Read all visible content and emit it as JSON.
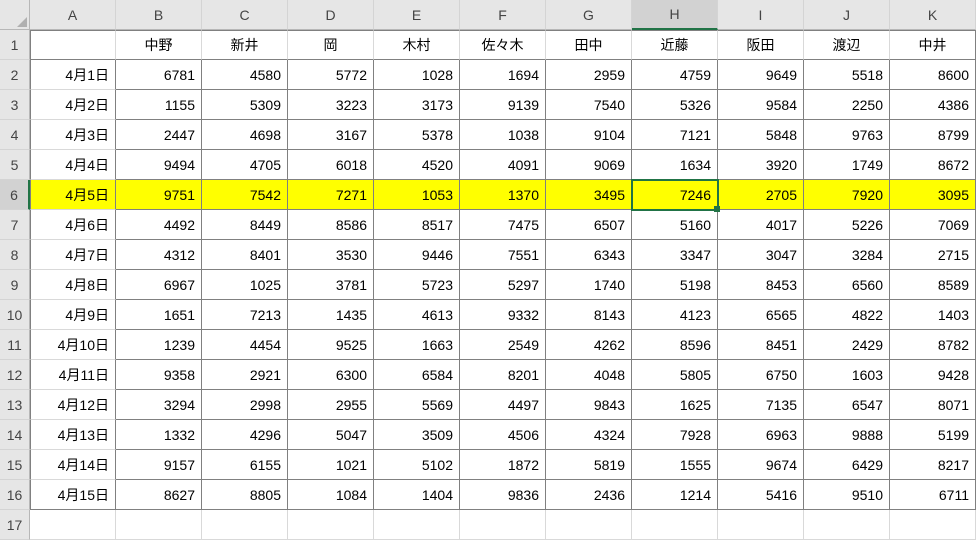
{
  "columns": [
    "A",
    "B",
    "C",
    "D",
    "E",
    "F",
    "G",
    "H",
    "I",
    "J",
    "K"
  ],
  "row_numbers": [
    1,
    2,
    3,
    4,
    5,
    6,
    7,
    8,
    9,
    10,
    11,
    12,
    13,
    14,
    15,
    16,
    17
  ],
  "header_row": [
    "",
    "中野",
    "新井",
    "岡",
    "木村",
    "佐々木",
    "田中",
    "近藤",
    "阪田",
    "渡辺",
    "中井"
  ],
  "data_rows": [
    {
      "label": "4月1日",
      "values": [
        6781,
        4580,
        5772,
        1028,
        1694,
        2959,
        4759,
        9649,
        5518,
        8600
      ]
    },
    {
      "label": "4月2日",
      "values": [
        1155,
        5309,
        3223,
        3173,
        9139,
        7540,
        5326,
        9584,
        2250,
        4386
      ]
    },
    {
      "label": "4月3日",
      "values": [
        2447,
        4698,
        3167,
        5378,
        1038,
        9104,
        7121,
        5848,
        9763,
        8799
      ]
    },
    {
      "label": "4月4日",
      "values": [
        9494,
        4705,
        6018,
        4520,
        4091,
        9069,
        1634,
        3920,
        1749,
        8672
      ]
    },
    {
      "label": "4月5日",
      "values": [
        9751,
        7542,
        7271,
        1053,
        1370,
        3495,
        7246,
        2705,
        7920,
        3095
      ]
    },
    {
      "label": "4月6日",
      "values": [
        4492,
        8449,
        8586,
        8517,
        7475,
        6507,
        5160,
        4017,
        5226,
        7069
      ]
    },
    {
      "label": "4月7日",
      "values": [
        4312,
        8401,
        3530,
        9446,
        7551,
        6343,
        3347,
        3047,
        3284,
        2715
      ]
    },
    {
      "label": "4月8日",
      "values": [
        6967,
        1025,
        3781,
        5723,
        5297,
        1740,
        5198,
        8453,
        6560,
        8589
      ]
    },
    {
      "label": "4月9日",
      "values": [
        1651,
        7213,
        1435,
        4613,
        9332,
        8143,
        4123,
        6565,
        4822,
        1403
      ]
    },
    {
      "label": "4月10日",
      "values": [
        1239,
        4454,
        9525,
        1663,
        2549,
        4262,
        8596,
        8451,
        2429,
        8782
      ]
    },
    {
      "label": "4月11日",
      "values": [
        9358,
        2921,
        6300,
        6584,
        8201,
        4048,
        5805,
        6750,
        1603,
        9428
      ]
    },
    {
      "label": "4月12日",
      "values": [
        3294,
        2998,
        2955,
        5569,
        4497,
        9843,
        1625,
        7135,
        6547,
        8071
      ]
    },
    {
      "label": "4月13日",
      "values": [
        1332,
        4296,
        5047,
        3509,
        4506,
        4324,
        7928,
        6963,
        9888,
        5199
      ]
    },
    {
      "label": "4月14日",
      "values": [
        9157,
        6155,
        1021,
        5102,
        1872,
        5819,
        1555,
        9674,
        6429,
        8217
      ]
    },
    {
      "label": "4月15日",
      "values": [
        8627,
        8805,
        1084,
        1404,
        9836,
        2436,
        1214,
        5416,
        9510,
        6711
      ]
    }
  ],
  "highlight_row_index": 4,
  "active_cell": {
    "row": 6,
    "col": "H"
  },
  "chart_data": {
    "type": "table",
    "title": "",
    "categories": [
      "中野",
      "新井",
      "岡",
      "木村",
      "佐々木",
      "田中",
      "近藤",
      "阪田",
      "渡辺",
      "中井"
    ],
    "series": [
      {
        "name": "4月1日",
        "values": [
          6781,
          4580,
          5772,
          1028,
          1694,
          2959,
          4759,
          9649,
          5518,
          8600
        ]
      },
      {
        "name": "4月2日",
        "values": [
          1155,
          5309,
          3223,
          3173,
          9139,
          7540,
          5326,
          9584,
          2250,
          4386
        ]
      },
      {
        "name": "4月3日",
        "values": [
          2447,
          4698,
          3167,
          5378,
          1038,
          9104,
          7121,
          5848,
          9763,
          8799
        ]
      },
      {
        "name": "4月4日",
        "values": [
          9494,
          4705,
          6018,
          4520,
          4091,
          9069,
          1634,
          3920,
          1749,
          8672
        ]
      },
      {
        "name": "4月5日",
        "values": [
          9751,
          7542,
          7271,
          1053,
          1370,
          3495,
          7246,
          2705,
          7920,
          3095
        ]
      },
      {
        "name": "4月6日",
        "values": [
          4492,
          8449,
          8586,
          8517,
          7475,
          6507,
          5160,
          4017,
          5226,
          7069
        ]
      },
      {
        "name": "4月7日",
        "values": [
          4312,
          8401,
          3530,
          9446,
          7551,
          6343,
          3347,
          3047,
          3284,
          2715
        ]
      },
      {
        "name": "4月8日",
        "values": [
          6967,
          1025,
          3781,
          5723,
          5297,
          1740,
          5198,
          8453,
          6560,
          8589
        ]
      },
      {
        "name": "4月9日",
        "values": [
          1651,
          7213,
          1435,
          4613,
          9332,
          8143,
          4123,
          6565,
          4822,
          1403
        ]
      },
      {
        "name": "4月10日",
        "values": [
          1239,
          4454,
          9525,
          1663,
          2549,
          4262,
          8596,
          8451,
          2429,
          8782
        ]
      },
      {
        "name": "4月11日",
        "values": [
          9358,
          2921,
          6300,
          6584,
          8201,
          4048,
          5805,
          6750,
          1603,
          9428
        ]
      },
      {
        "name": "4月12日",
        "values": [
          3294,
          2998,
          2955,
          5569,
          4497,
          9843,
          1625,
          7135,
          6547,
          8071
        ]
      },
      {
        "name": "4月13日",
        "values": [
          1332,
          4296,
          5047,
          3509,
          4506,
          4324,
          7928,
          6963,
          9888,
          5199
        ]
      },
      {
        "name": "4月14日",
        "values": [
          9157,
          6155,
          1021,
          5102,
          1872,
          5819,
          1555,
          9674,
          6429,
          8217
        ]
      },
      {
        "name": "4月15日",
        "values": [
          8627,
          8805,
          1084,
          1404,
          9836,
          2436,
          1214,
          5416,
          9510,
          6711
        ]
      }
    ]
  }
}
